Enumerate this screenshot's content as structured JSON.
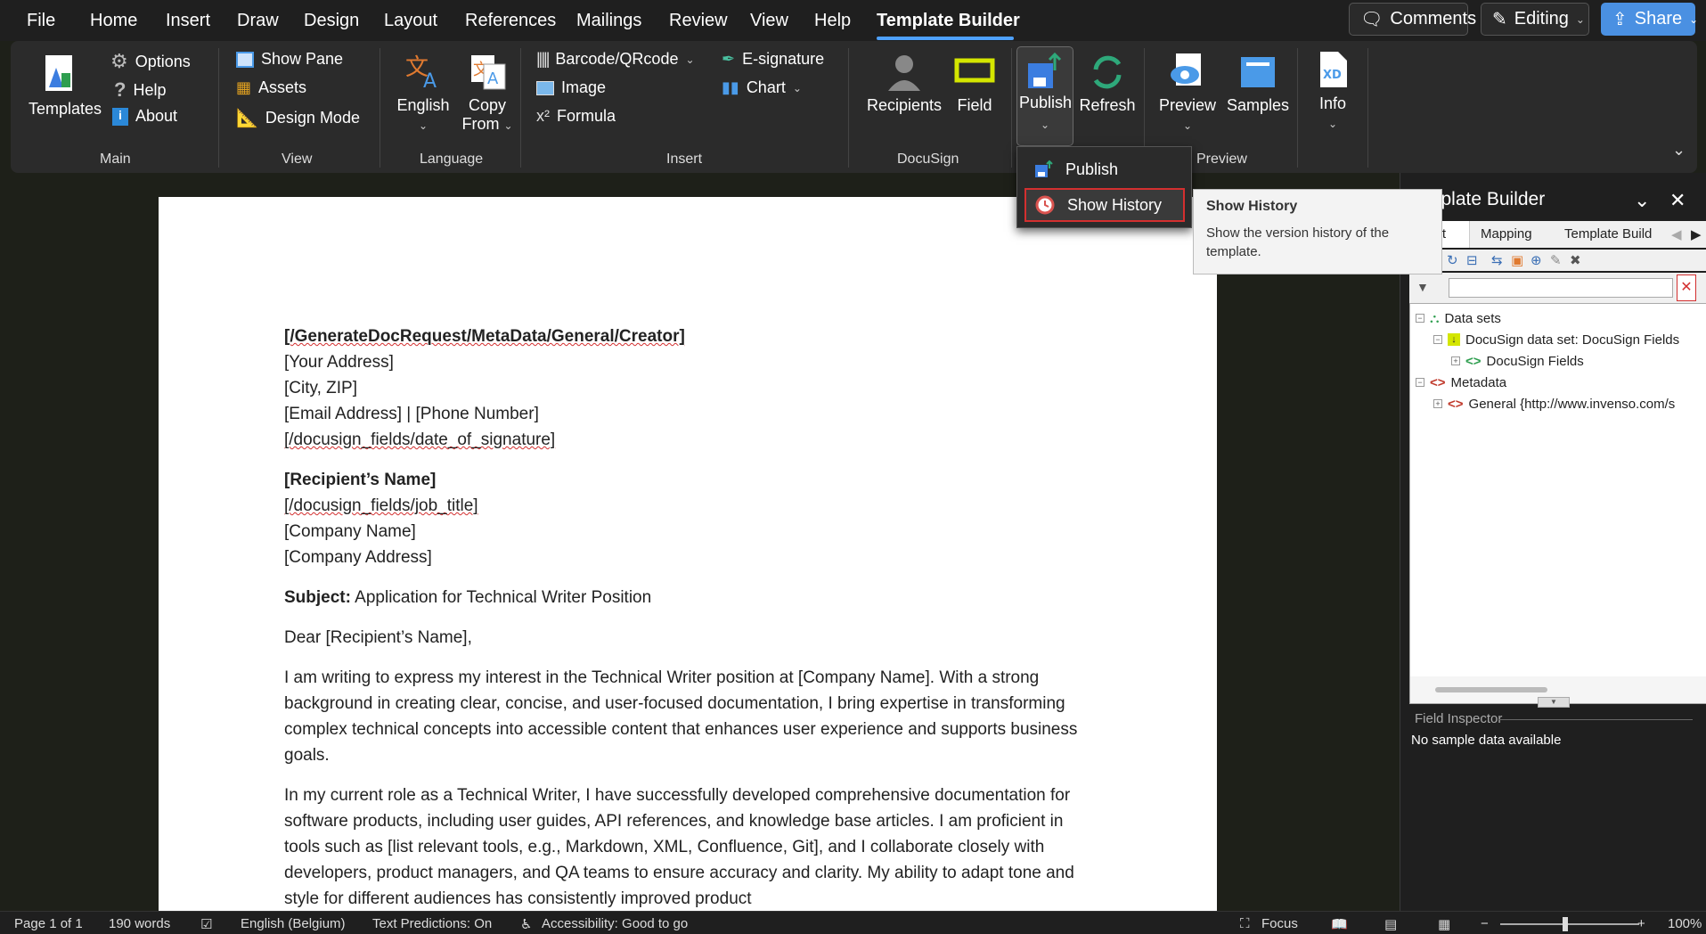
{
  "menubar": {
    "tabs": [
      "File",
      "Home",
      "Insert",
      "Draw",
      "Design",
      "Layout",
      "References",
      "Mailings",
      "Review",
      "View",
      "Help",
      "Template Builder"
    ],
    "comments_label": "Comments",
    "editing_label": "Editing",
    "share_label": "Share"
  },
  "ribbon": {
    "main": {
      "templates": "Templates",
      "options": "Options",
      "help": "Help",
      "about": "About",
      "label": "Main"
    },
    "view": {
      "show_pane": "Show Pane",
      "assets": "Assets",
      "design_mode": "Design Mode",
      "label": "View"
    },
    "language": {
      "english": "English",
      "copy": "Copy",
      "from": "From",
      "label": "Language"
    },
    "insert": {
      "barcode": "Barcode/QRcode",
      "image": "Image",
      "formula": "Formula",
      "esignature": "E-signature",
      "chart": "Chart",
      "label": "Insert"
    },
    "docusign": {
      "recipients": "Recipients",
      "field": "Field",
      "label": "DocuSign"
    },
    "publish": {
      "publish": "Publish",
      "refresh": "Refresh"
    },
    "preview": {
      "preview": "Preview",
      "samples": "Samples",
      "label": "Preview"
    },
    "info": {
      "info": "Info"
    }
  },
  "publish_menu": {
    "publish": "Publish",
    "show_history": "Show History"
  },
  "tooltip": {
    "title": "Show History",
    "description": "Show the version history of the template."
  },
  "document": {
    "creator": "[/GenerateDocRequest/MetaData/General/Creator]",
    "address": "[Your Address]",
    "city": "[City, ZIP]",
    "contact": "[Email Address] | [Phone Number]",
    "date": "[/docusign_fields/date_of_signature]",
    "recipient": "[Recipient’s Name]",
    "job_title": "[/docusign_fields/job_title]",
    "company": "[Company Name]",
    "company_address": "[Company Address]",
    "subject_label": "Subject:",
    "subject_text": " Application for Technical Writer Position",
    "salutation": "Dear [Recipient’s Name],",
    "para1": "I am writing to express my interest in the Technical Writer position at [Company Name]. With a strong background in creating clear, concise, and user-focused documentation, I bring expertise in transforming complex technical concepts into accessible content that enhances user experience and supports business goals.",
    "para2": "In my current role as a Technical Writer, I have successfully developed comprehensive documentation for software products, including user guides, API references, and knowledge base articles. I am proficient in tools such as [list relevant tools, e.g., Markdown, XML, Confluence, Git], and I collaborate closely with developers, product managers, and QA teams to ensure accuracy and clarity. My ability to adapt tone and style for different audiences has consistently improved product"
  },
  "side_panel": {
    "title": "mplate Builder",
    "tabs": [
      "a Set",
      "Mapping",
      "Template Build"
    ],
    "tree": [
      "Data sets",
      "DocuSign data set: DocuSign Fields",
      "DocuSign Fields",
      "Metadata",
      "General {http://www.invenso.com/s"
    ],
    "field_inspector_label": "Field Inspector",
    "field_inspector_empty": "No sample data available"
  },
  "statusbar": {
    "page": "Page 1 of 1",
    "words": "190 words",
    "language": "English (Belgium)",
    "predictions": "Text Predictions: On",
    "accessibility": "Accessibility: Good to go",
    "focus": "Focus",
    "zoom": "100%"
  }
}
